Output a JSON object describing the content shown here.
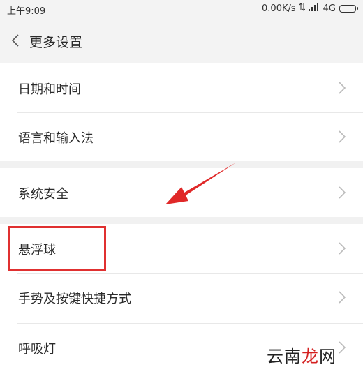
{
  "statusbar": {
    "time": "上午9:09",
    "speed": "0.00K/s",
    "network": "4G",
    "icons": [
      "data-arrows-icon",
      "signal-icon",
      "battery-icon"
    ]
  },
  "header": {
    "title": "更多设置",
    "back_icon": "chevron-left-icon"
  },
  "sections": [
    {
      "items": [
        "日期和时间",
        "语言和输入法"
      ]
    },
    {
      "items": [
        "系统安全"
      ]
    },
    {
      "items": [
        "悬浮球",
        "手势及按键快捷方式",
        "呼吸灯"
      ]
    }
  ],
  "annotations": {
    "highlight_color": "#e03030",
    "highlighted_item": "悬浮球"
  },
  "watermark": {
    "part1": "云南",
    "part2": "龙",
    "part3": "网"
  }
}
